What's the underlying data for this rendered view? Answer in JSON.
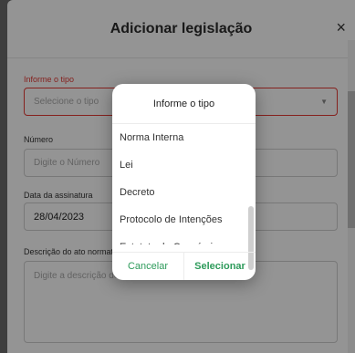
{
  "modal": {
    "title": "Adicionar legislação",
    "close_icon": "×"
  },
  "form": {
    "tipo_label": "Informe o tipo",
    "tipo_placeholder": "Selecione o tipo",
    "numero_label": "Número",
    "numero_placeholder": "Digite o Número",
    "data_label": "Data da assinatura",
    "data_value": "28/04/2023",
    "descricao_label": "Descrição do ato normativo",
    "descricao_placeholder": "Digite a descrição do ato normativo"
  },
  "picker": {
    "title": "Informe o tipo",
    "options": [
      "Norma Interna",
      "Lei",
      "Decreto",
      "Protocolo de Intenções",
      "Estatuto do Consórcio"
    ],
    "cancel_label": "Cancelar",
    "select_label": "Selecionar"
  },
  "colors": {
    "error": "#e53935",
    "accent": "#2e9b5b"
  }
}
